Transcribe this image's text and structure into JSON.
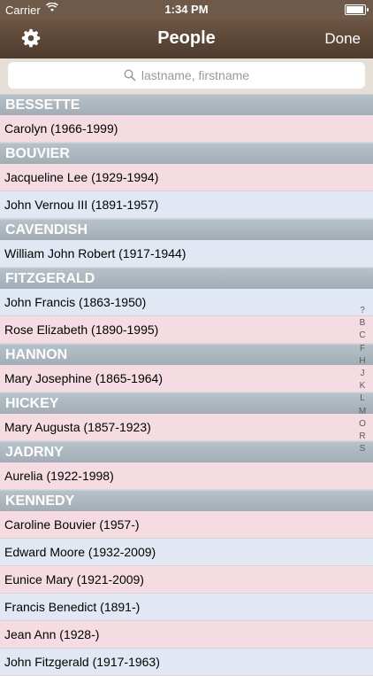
{
  "status": {
    "carrier": "Carrier",
    "time": "1:34 PM",
    "battery_fraction": 0.95
  },
  "nav": {
    "title": "People",
    "done_label": "Done"
  },
  "search": {
    "placeholder": "lastname, firstname"
  },
  "sections": [
    {
      "header": "BESSETTE",
      "rows": [
        {
          "text": "Carolyn (1966-1999)",
          "tone": "pink"
        }
      ]
    },
    {
      "header": "BOUVIER",
      "rows": [
        {
          "text": "Jacqueline Lee (1929-1994)",
          "tone": "pink"
        },
        {
          "text": "John Vernou III (1891-1957)",
          "tone": "blue"
        }
      ]
    },
    {
      "header": "CAVENDISH",
      "rows": [
        {
          "text": "William John Robert (1917-1944)",
          "tone": "blue"
        }
      ]
    },
    {
      "header": "FITZGERALD",
      "rows": [
        {
          "text": "John Francis (1863-1950)",
          "tone": "blue"
        },
        {
          "text": "Rose Elizabeth (1890-1995)",
          "tone": "pink"
        }
      ]
    },
    {
      "header": "HANNON",
      "rows": [
        {
          "text": "Mary Josephine (1865-1964)",
          "tone": "pink"
        }
      ]
    },
    {
      "header": "HICKEY",
      "rows": [
        {
          "text": "Mary Augusta (1857-1923)",
          "tone": "pink"
        }
      ]
    },
    {
      "header": "JADRNY",
      "rows": [
        {
          "text": "Aurelia (1922-1998)",
          "tone": "pink"
        }
      ]
    },
    {
      "header": "KENNEDY",
      "rows": [
        {
          "text": "Caroline Bouvier (1957-)",
          "tone": "pink"
        },
        {
          "text": "Edward Moore (1932-2009)",
          "tone": "blue"
        },
        {
          "text": "Eunice Mary (1921-2009)",
          "tone": "pink"
        },
        {
          "text": "Francis Benedict (1891-)",
          "tone": "blue"
        },
        {
          "text": "Jean Ann (1928-)",
          "tone": "pink"
        },
        {
          "text": "John Fitzgerald (1917-1963)",
          "tone": "blue"
        }
      ]
    }
  ],
  "index": [
    "?",
    "B",
    "C",
    "F",
    "H",
    "J",
    "K",
    "L",
    "M",
    "O",
    "R",
    "S"
  ]
}
